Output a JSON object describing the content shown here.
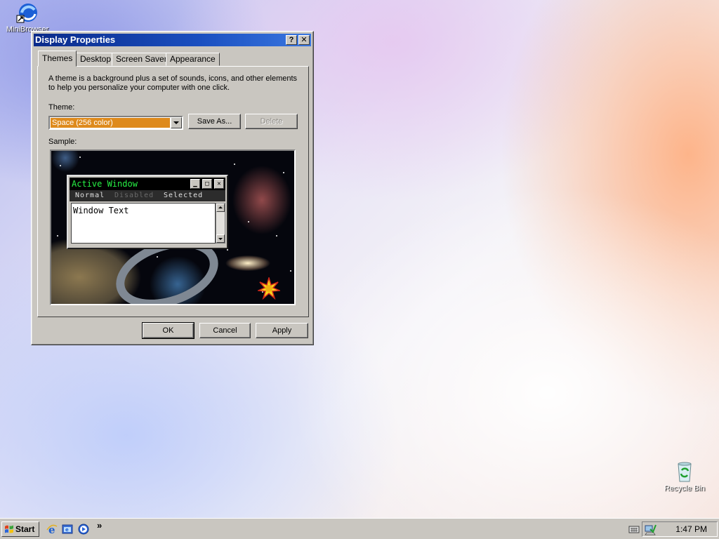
{
  "desktop": {
    "icons": [
      {
        "label": "MiniBrowser"
      },
      {
        "label": "Recycle Bin"
      }
    ]
  },
  "dialog": {
    "title": "Display Properties",
    "help_glyph": "?",
    "close_glyph": "✕",
    "tabs": [
      {
        "label": "Themes",
        "active": true
      },
      {
        "label": "Desktop"
      },
      {
        "label": "Screen Saver"
      },
      {
        "label": "Appearance"
      }
    ],
    "description": "A theme is a background plus a set of sounds, icons, and other elements to help you personalize your computer with one click.",
    "theme_label": "Theme:",
    "theme_value": "Space (256 color)",
    "save_as_label": "Save As...",
    "delete_label": "Delete",
    "sample_label": "Sample:",
    "preview": {
      "title": "Active Window",
      "menu_normal": "Normal",
      "menu_disabled": "Disabled",
      "menu_selected": "Selected",
      "window_text": "Window Text"
    },
    "ok_label": "OK",
    "cancel_label": "Cancel",
    "apply_label": "Apply"
  },
  "taskbar": {
    "start_label": "Start",
    "quick_launch": [
      "internet-explorer-icon",
      "show-desktop-icon",
      "media-player-icon"
    ],
    "chevron": "»",
    "clock": "1:47 PM"
  },
  "colors": {
    "accent_titlebar": "#1a4fc0",
    "selected_theme": "#de8a1c",
    "preview_title_text": "#27f045"
  }
}
